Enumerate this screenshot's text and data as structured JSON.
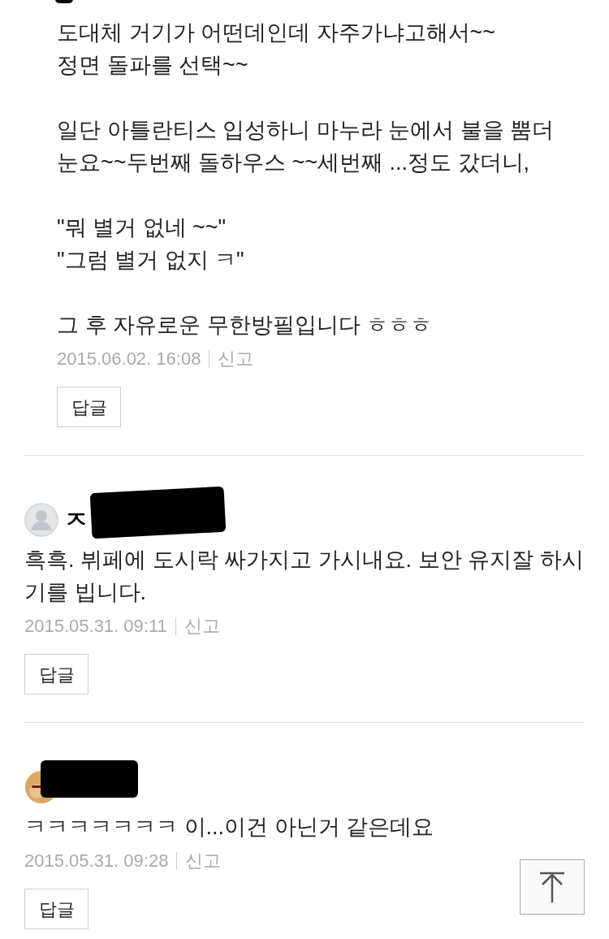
{
  "comments": [
    {
      "kind": "reply",
      "redacted_header": true,
      "paragraphs": [
        "도대체 거기가 어떤데인데 자주가냐고해서~~\n정면 돌파를 선택~~",
        "일단 아틀란티스 입성하니 마누라 눈에서 불을 뿜더\n눈요~~두번째 돌하우스 ~~세번째 ...정도 갔더니,",
        "\"뭐 별거 없네 ~~\"\n\"그럼 별거 없지 ㅋ\"",
        "그 후 자유로운 무한방필입니다 ㅎㅎㅎ"
      ],
      "date": "2015.06.02. 16:08",
      "report": "신고",
      "reply_button": "답글"
    },
    {
      "kind": "comment",
      "avatar": {
        "kind": "default"
      },
      "author": "ㅈ",
      "paragraphs": [
        "흑흑. 뷔페에 도시락 싸가지고 가시내요. 보안 유지잘 하시기를 빕니다."
      ],
      "date": "2015.05.31. 09:11",
      "report": "신고",
      "reply_button": "답글"
    },
    {
      "kind": "comment",
      "paragraphs": [
        "ㅋㅋㅋㅋㅋㅋㅋ 이...이건 아닌거 같은데요"
      ],
      "date": "2015.05.31. 09:28",
      "report": "신고",
      "reply_button": "답글"
    }
  ]
}
